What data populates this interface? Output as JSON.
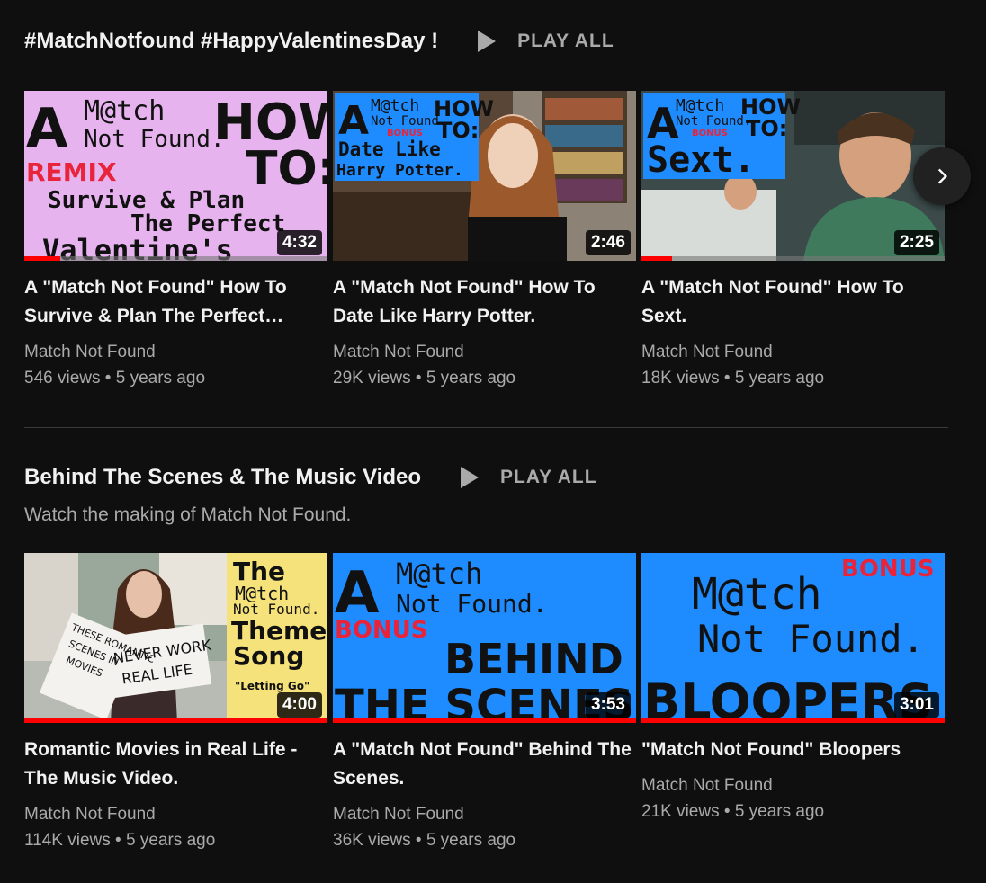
{
  "shelves": [
    {
      "title": "#MatchNotfound #HappyValentinesDay !",
      "play_all_label": "PLAY ALL",
      "description": "",
      "videos": [
        {
          "thumb_text": [
            "A",
            "M@tch",
            "Not Found.",
            "HOW",
            "TO:",
            "REMIX",
            "Survive & Plan",
            "The Perfect",
            "Valentine's"
          ],
          "duration": "4:32",
          "watched": 0.12,
          "title": "A \"Match Not Found\" How To Survive & Plan The Perfect…",
          "channel": "Match Not Found",
          "views": "546 views",
          "age": "5 years ago"
        },
        {
          "thumb_text": [
            "A",
            "M@tch",
            "Not Found.",
            "BONUS",
            "HOW",
            "TO:",
            "Date Like",
            "Harry Potter."
          ],
          "duration": "2:46",
          "watched": 0,
          "title": "A \"Match Not Found\" How To Date Like Harry Potter.",
          "channel": "Match Not Found",
          "views": "29K views",
          "age": "5 years ago"
        },
        {
          "thumb_text": [
            "A",
            "M@tch",
            "Not Found.",
            "BONUS",
            "HOW",
            "TO:",
            "Sext."
          ],
          "duration": "2:25",
          "watched": 0.1,
          "title": "A \"Match Not Found\" How To Sext.",
          "channel": "Match Not Found",
          "views": "18K views",
          "age": "5 years ago"
        }
      ]
    },
    {
      "title": "Behind The Scenes & The Music Video",
      "play_all_label": "PLAY ALL",
      "description": "Watch the making of Match Not Found.",
      "videos": [
        {
          "thumb_text": [
            "The",
            "M@tch",
            "Not Found.",
            "Theme",
            "Song",
            "\"Letting Go\"",
            "NEVER WORK",
            "REAL LIFE",
            "THESE ROMANTIC",
            "SCENES IN",
            "MOVIES"
          ],
          "duration": "4:00",
          "watched": 1,
          "title": "Romantic Movies in Real Life -The Music Video.",
          "channel": "Match Not Found",
          "views": "114K views",
          "age": "5 years ago"
        },
        {
          "thumb_text": [
            "A",
            "M@tch",
            "Not Found.",
            "BONUS",
            "BEHIND",
            "THE SCENES"
          ],
          "duration": "3:53",
          "watched": 1,
          "title": "A \"Match Not Found\" Behind The Scenes.",
          "channel": "Match Not Found",
          "views": "36K views",
          "age": "5 years ago"
        },
        {
          "thumb_text": [
            "BONUS",
            "M@tch",
            "Not Found.",
            "BLOOPERS"
          ],
          "duration": "3:01",
          "watched": 1,
          "title": "\"Match Not Found\" Bloopers",
          "channel": "Match Not Found",
          "views": "21K views",
          "age": "5 years ago"
        }
      ]
    }
  ],
  "meta_separator": "•",
  "colors": {
    "background": "#0f0f0f",
    "text": "#f1f1f1",
    "secondary": "#aaaaaa",
    "progress": "#ff0000",
    "thumb_pink": "#e6b3ee",
    "thumb_blue": "#1e8cff",
    "thumb_yellow": "#f6e27a"
  },
  "icons": {
    "play": "play-icon",
    "next": "chevron-right-icon"
  }
}
